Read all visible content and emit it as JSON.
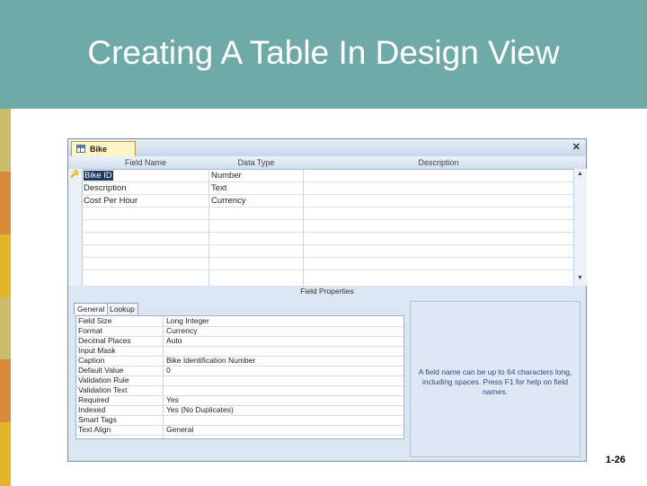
{
  "slide": {
    "title": "Creating A Table In Design View",
    "number": "1-26",
    "colors": {
      "header": "#6fa9a8",
      "stripe": [
        "#c9bd6a",
        "#d8893a",
        "#e2b628",
        "#c9bd6a",
        "#d8893a",
        "#e2b628"
      ]
    }
  },
  "window": {
    "tab_label": "Bike",
    "close_icon": "close-icon",
    "columns": [
      "Field Name",
      "Data Type",
      "Description"
    ],
    "rows": [
      {
        "field": "Bike ID",
        "type": "Number",
        "description": ""
      },
      {
        "field": "Description",
        "type": "Text",
        "description": ""
      },
      {
        "field": "Cost Per Hour",
        "type": "Currency",
        "description": ""
      }
    ],
    "field_properties_label": "Field Properties",
    "tabs": [
      "General",
      "Lookup"
    ],
    "properties": [
      {
        "name": "Field Size",
        "value": "Long Integer"
      },
      {
        "name": "Format",
        "value": "Currency"
      },
      {
        "name": "Decimal Places",
        "value": "Auto"
      },
      {
        "name": "Input Mask",
        "value": ""
      },
      {
        "name": "Caption",
        "value": "Bike Identification Number"
      },
      {
        "name": "Default Value",
        "value": "0"
      },
      {
        "name": "Validation Rule",
        "value": ""
      },
      {
        "name": "Validation Text",
        "value": ""
      },
      {
        "name": "Required",
        "value": "Yes"
      },
      {
        "name": "Indexed",
        "value": "Yes (No Duplicates)"
      },
      {
        "name": "Smart Tags",
        "value": ""
      },
      {
        "name": "Text Align",
        "value": "General"
      }
    ],
    "help_text": "A field name can be up to 64 characters long, including spaces. Press F1 for help on field names."
  }
}
